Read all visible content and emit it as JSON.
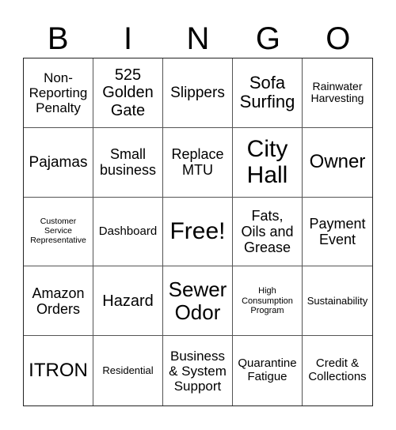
{
  "header": {
    "letters": [
      "B",
      "I",
      "N",
      "G",
      "O"
    ]
  },
  "card": {
    "cells": [
      "Non-\nReporting\nPenalty",
      "525\nGolden\nGate",
      "Slippers",
      "Sofa\nSurfing",
      "Rainwater\nHarvesting",
      "Pajamas",
      "Small\nbusiness",
      "Replace\nMTU",
      "City\nHall",
      "Owner",
      "Customer\nService\nRepresentative",
      "Dashboard",
      "Free!",
      "Fats,\nOils and\nGrease",
      "Payment\nEvent",
      "Amazon\nOrders",
      "Hazard",
      "Sewer\nOdor",
      "High\nConsumption\nProgram",
      "Sustainability",
      "ITRON",
      "Residential",
      "Business\n& System\nSupport",
      "Quarantine\nFatigue",
      "Credit &\nCollections"
    ],
    "free_space_index": 12
  }
}
